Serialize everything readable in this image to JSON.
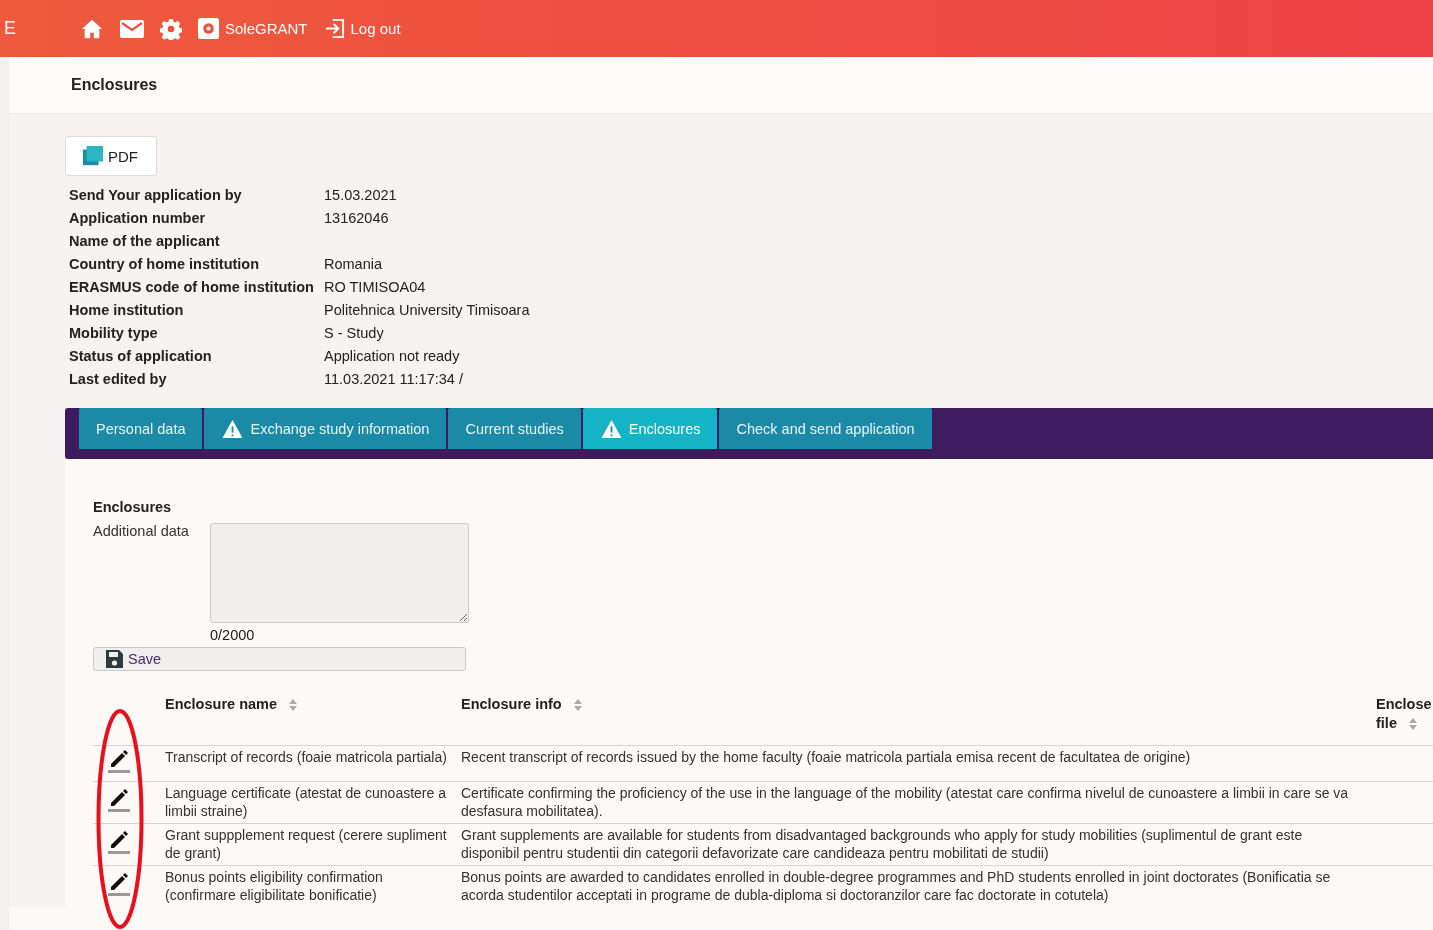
{
  "topbar": {
    "brand_fragment": "E",
    "links": [
      {
        "kind": "home"
      },
      {
        "kind": "mail"
      },
      {
        "kind": "settings"
      },
      {
        "kind": "app",
        "label": "SoleGRANT"
      },
      {
        "kind": "logout",
        "label": "Log out"
      }
    ]
  },
  "page_title": "Enclosures",
  "pdf_button": "PDF",
  "summary": [
    {
      "label": "Send Your application by",
      "value": "15.03.2021"
    },
    {
      "label": "Application number",
      "value": "13162046"
    },
    {
      "label": "Name of the applicant"
    },
    {
      "label": "Country of home institution",
      "value": "Romania"
    },
    {
      "label": "ERASMUS code of home institution",
      "value": "RO TIMISOA04"
    },
    {
      "label": "Home institution",
      "value": "Politehnica University Timisoara"
    },
    {
      "label": "Mobility type",
      "value": "S - Study"
    },
    {
      "label": "Status of application",
      "value": "Application not ready"
    },
    {
      "label": "Last edited by",
      "value": "11.03.2021 11:17:34 /"
    }
  ],
  "tabs": [
    {
      "label": "Personal data",
      "selected": false,
      "warning": false
    },
    {
      "label": "Exchange study information",
      "selected": false,
      "warning": true
    },
    {
      "label": "Current studies",
      "selected": false,
      "warning": false
    },
    {
      "label": "Enclosures",
      "selected": true,
      "warning": true
    },
    {
      "label": "Check and send application",
      "selected": false,
      "warning": false
    }
  ],
  "form": {
    "heading": "Enclosures",
    "field_label": "Additional data",
    "counter": "0/2000",
    "save_button": "Save"
  },
  "table": {
    "columns": [
      "Enclosure name",
      "Enclosure info",
      "Enclose file"
    ],
    "rows": [
      {
        "name": "Transcript of records (foaie matricola partiala)",
        "info": "Recent transcript of records issued by the home faculty (foaie matricola partiala emisa recent de facultatea de origine)"
      },
      {
        "name": "Language certificate (atestat de cunoastere a limbii straine)",
        "info": "Certificate confirming the proficiency of the use in the language of the mobility (atestat care confirma nivelul de cunoastere a limbii in care se va desfasura mobilitatea)."
      },
      {
        "name": "Grant suppplement request (cerere supliment de grant)",
        "info": "Grant supplements are available for students from disadvantaged backgrounds who apply for study mobilities (suplimentul de grant este disponibil pentru studentii din categorii defavorizate care candideaza pentru mobilitati de studii)"
      },
      {
        "name": "Bonus points eligibility confirmation (confirmare eligibilitate bonificatie)",
        "info": "Bonus points are awarded to candidates enrolled in double-degree programmes and PhD students enrolled in joint doctorates (Bonificatia se acorda studentilor acceptati in programe de dubla-diploma si doctoranzilor care fac doctorate in cotutela)"
      }
    ]
  }
}
